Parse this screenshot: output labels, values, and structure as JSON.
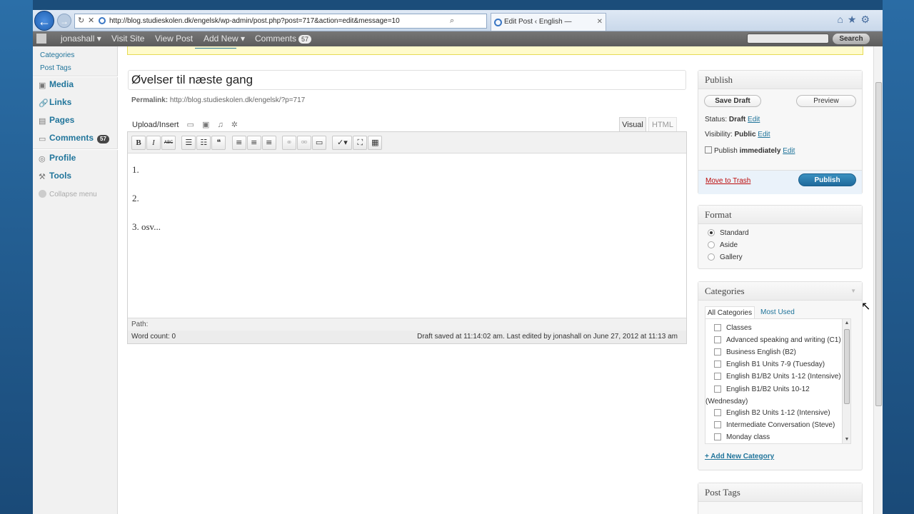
{
  "browser": {
    "url": "http://blog.studieskolen.dk/engelsk/wp-admin/post.php?post=717&action=edit&message=10",
    "tab_title": "Edit Post ‹ English — WordPress",
    "tab_close": "✕",
    "refresh_glyph": "↻",
    "stop_glyph": "✕",
    "search_glyph": "⌕",
    "back_glyph": "←",
    "fwd_glyph": "→",
    "icons": "⌂★⚙"
  },
  "adminbar": {
    "user": "jonashall ▾",
    "visit_site": "Visit Site",
    "view_post": "View Post",
    "add_new": "Add New ▾",
    "comments": "Comments",
    "comments_count": "57",
    "search_label": "Search"
  },
  "sidebar": {
    "sub_items": [
      "Categories",
      "Post Tags"
    ],
    "items": [
      {
        "label": "Media",
        "icon": "media-icon",
        "glyph": "▣"
      },
      {
        "label": "Links",
        "icon": "links-icon",
        "glyph": "🔗"
      },
      {
        "label": "Pages",
        "icon": "pages-icon",
        "glyph": "▤"
      },
      {
        "label": "Comments",
        "icon": "comments-icon",
        "glyph": "▭",
        "count": "57"
      },
      {
        "label": "Profile",
        "icon": "profile-icon",
        "glyph": "◎"
      },
      {
        "label": "Tools",
        "icon": "tools-icon",
        "glyph": "⚒"
      }
    ],
    "collapse": "Collapse menu"
  },
  "editor": {
    "title": "Øvelser til næste gang",
    "permalink_label": "Permalink:",
    "permalink_url": "http://blog.studieskolen.dk/engelsk/?p=717",
    "upload_insert": "Upload/Insert",
    "tab_visual": "Visual",
    "tab_html": "HTML",
    "toolbar": {
      "bold": "B",
      "italic": "I",
      "strike": "ABC",
      "bullets": "☰",
      "numbers": "☷",
      "quote": "❝",
      "align_left": "≡",
      "align_center": "≡",
      "align_right": "≡",
      "link": "⚭",
      "unlink": "⚮",
      "more": "▭",
      "spell": "✓▾",
      "fullscreen": "⛶",
      "kitchen": "▦"
    },
    "lines": [
      "1.",
      "2.",
      "3. osv..."
    ],
    "path_label": "Path:",
    "word_count": "Word count: 0",
    "draft_status": "Draft saved at 11:14:02 am. Last edited by jonashall on June 27, 2012 at 11:13 am"
  },
  "publish": {
    "heading": "Publish",
    "save_draft": "Save Draft",
    "preview": "Preview",
    "status_label": "Status:",
    "status_value": "Draft",
    "visibility_label": "Visibility:",
    "visibility_value": "Public",
    "publish_label": "Publish",
    "publish_value": "immediately",
    "edit": "Edit",
    "move_to_trash": "Move to Trash",
    "publish_button": "Publish"
  },
  "format": {
    "heading": "Format",
    "options": [
      "Standard",
      "Aside",
      "Gallery"
    ],
    "selected": "Standard"
  },
  "categories": {
    "heading": "Categories",
    "tab_all": "All Categories",
    "tab_used": "Most Used",
    "items": [
      "Classes",
      "Advanced speaking and writing (C1)",
      "Business English (B2)",
      "English B1 Units 7-9 (Tuesday)",
      "English B1/B2 Units 1-12 (Intensive)",
      "English B1/B2 Units 10-12",
      "(Wednesday)",
      "English B2 Units 1-12 (Intensive)",
      "Intermediate Conversation (Steve)",
      "Monday class"
    ],
    "add_new": "+ Add New Category"
  },
  "tags": {
    "heading": "Post Tags"
  }
}
